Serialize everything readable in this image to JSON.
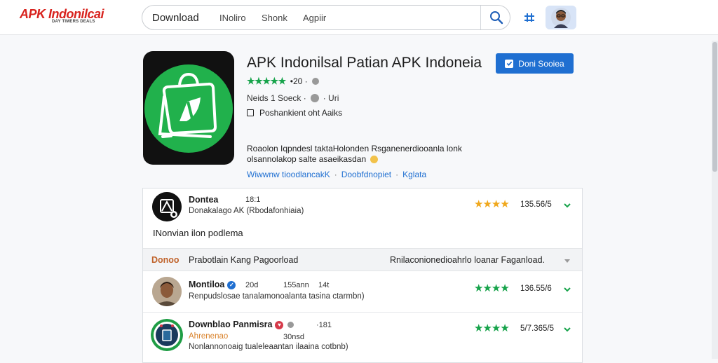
{
  "header": {
    "logo_text": "APK Indonilcai",
    "logo_tagline": "DAY TIMERS DEALS",
    "search_value": "Download",
    "search_chips": [
      "INoliro",
      "Shonk",
      "Agpiir"
    ]
  },
  "app": {
    "title": "APK Indonilsal Patian APK Indoneia",
    "rating_stars": "★★★★★",
    "rating_count": "•20 ·",
    "meta": "Neids 1 Soeck ·",
    "meta_after": "· Uri",
    "checkbox_label": "Poshankient oht Aaiks",
    "description": "Roaolon Iqpndesl taktaHolonden Rsganenerdiooanla lonk olsannolakop salte asaeikasdan",
    "links": [
      "Wiwwnw tioodlancakK",
      "Doobfdnopiet",
      "Kglata"
    ],
    "cta_label": "Doni Sooiea"
  },
  "list": {
    "rows": [
      {
        "name": "Dontea",
        "meta": "18:1",
        "sub": "Donakalago AK (Rbodafonhiaia)",
        "score": "135.56/5",
        "stars": "★★★★",
        "star_color": "#f0a81c"
      },
      {
        "name": "Montiloa",
        "meta1": "20d",
        "meta2": "155ann",
        "meta3": "14t",
        "sub": "Renpudslosae tanalamonoalanta tasina ctarmbn)",
        "score": "136.55/6",
        "stars": "★★★★",
        "star_color": "#16a34a"
      },
      {
        "name": "Downblao Panmisra",
        "meta": "·181",
        "sub_orange": "Ahrenenao",
        "sub_meta": "30nsd",
        "sub2": "Nonlannonoaig tualeleaantan ilaaina cotbnb)",
        "score": "5/7.365/5",
        "stars": "★★★★",
        "star_color": "#16a34a"
      }
    ],
    "body_text": "INonvian ilon podlema",
    "section": {
      "tag": "Donoo",
      "title": "Prabotlain Kang Pagoorload",
      "right": "Rnilaconionedioahrlo loanar Faganload."
    }
  },
  "colors": {
    "brand": "#d8231e",
    "accent": "#1f6fd1",
    "star_green": "#16a34a",
    "star_gold": "#f0a81c"
  }
}
